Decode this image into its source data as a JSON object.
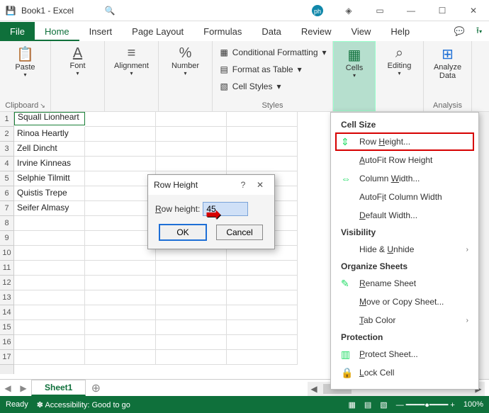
{
  "titlebar": {
    "title": "Book1 - Excel"
  },
  "tabs": {
    "file": "File",
    "items": [
      "Home",
      "Insert",
      "Page Layout",
      "Formulas",
      "Data",
      "Review",
      "View",
      "Help"
    ],
    "activeIndex": 0
  },
  "ribbon": {
    "clipboard": {
      "paste": "Paste",
      "group": "Clipboard"
    },
    "font": {
      "label": "Font"
    },
    "alignment": {
      "label": "Alignment"
    },
    "number": {
      "label": "Number"
    },
    "styles": {
      "cond": "Conditional Formatting",
      "table": "Format as Table",
      "cell": "Cell Styles",
      "group": "Styles"
    },
    "cells": {
      "label": "Cells"
    },
    "editing": {
      "label": "Editing"
    },
    "analysis": {
      "btn": "Analyze Data",
      "group": "Analysis"
    }
  },
  "rows": [
    "Squall Lionheart",
    "Rinoa Heartly",
    "Zell Dincht",
    "Irvine Kinneas",
    "Selphie Tilmitt",
    "Quistis Trepe",
    "Seifer Almasy"
  ],
  "selectedDisplay": "Squall Lionheart",
  "dropdown": {
    "cellsize": "Cell Size",
    "rowheight": "Row Height...",
    "autofitrow": "AutoFit Row Height",
    "colwidth": "Column Width...",
    "autofitcol": "AutoFit Column Width",
    "defwidth": "Default Width...",
    "visibility": "Visibility",
    "hideunhide": "Hide & Unhide",
    "organize": "Organize Sheets",
    "rename": "Rename Sheet",
    "movecopy": "Move or Copy Sheet...",
    "tabcolor": "Tab Color",
    "protection": "Protection",
    "protectsheet": "Protect Sheet...",
    "lockcell": "Lock Cell"
  },
  "dialog": {
    "title": "Row Height",
    "label": "Row height:",
    "value": "45",
    "ok": "OK",
    "cancel": "Cancel"
  },
  "sheets": {
    "active": "Sheet1"
  },
  "status": {
    "ready": "Ready",
    "access": "Accessibility: Good to go",
    "zoom": "100%"
  }
}
